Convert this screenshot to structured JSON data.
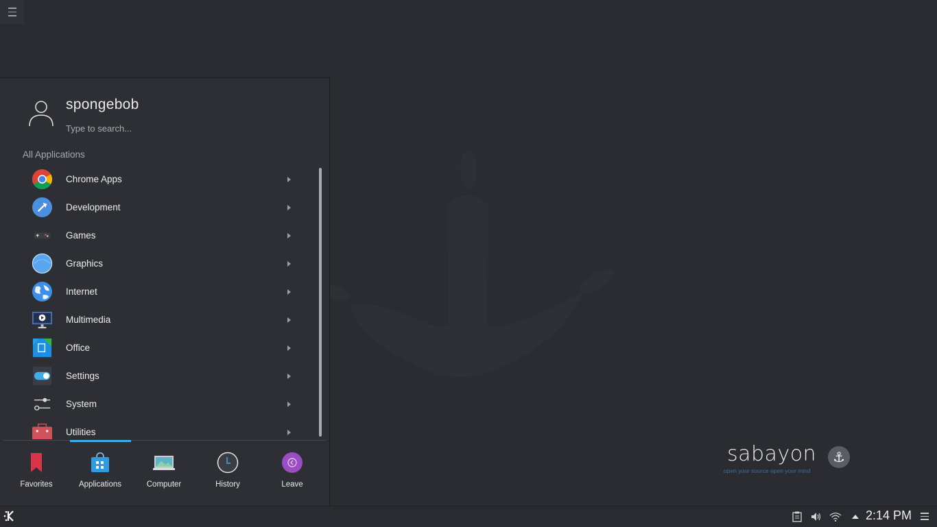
{
  "user": {
    "name": "spongebob"
  },
  "search": {
    "placeholder": "Type to search..."
  },
  "section_title": "All Applications",
  "apps": [
    {
      "label": "Chrome Apps",
      "icon": "chrome-icon"
    },
    {
      "label": "Development",
      "icon": "development-icon"
    },
    {
      "label": "Games",
      "icon": "gamepad-icon"
    },
    {
      "label": "Graphics",
      "icon": "graphics-icon"
    },
    {
      "label": "Internet",
      "icon": "globe-icon"
    },
    {
      "label": "Multimedia",
      "icon": "multimedia-icon"
    },
    {
      "label": "Office",
      "icon": "office-icon"
    },
    {
      "label": "Settings",
      "icon": "settings-toggle-icon"
    },
    {
      "label": "System",
      "icon": "system-sliders-icon"
    },
    {
      "label": "Utilities",
      "icon": "toolbox-icon"
    }
  ],
  "tabs": [
    {
      "label": "Favorites",
      "icon": "bookmark-icon"
    },
    {
      "label": "Applications",
      "icon": "applications-bag-icon",
      "active": true
    },
    {
      "label": "Computer",
      "icon": "computer-icon"
    },
    {
      "label": "History",
      "icon": "clock-icon"
    },
    {
      "label": "Leave",
      "icon": "leave-icon"
    }
  ],
  "branding": {
    "name": "sabayon",
    "tagline": "open your source open your mind"
  },
  "taskbar": {
    "clock": "2:14 PM"
  },
  "colors": {
    "accent": "#3daee9",
    "desktop": "#2b2c31",
    "panel": "#2d2f34"
  }
}
